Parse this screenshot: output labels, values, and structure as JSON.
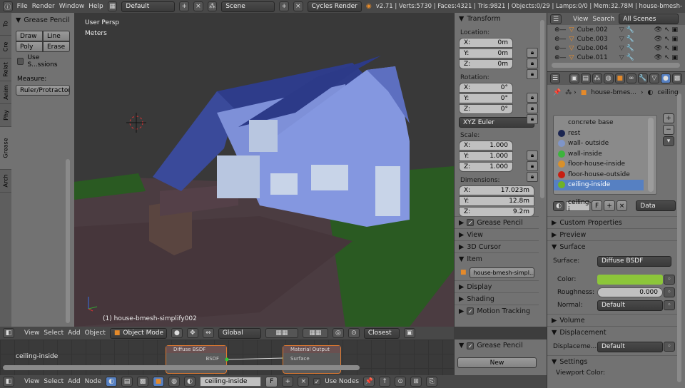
{
  "topbar": {
    "menus": [
      "File",
      "Render",
      "Window",
      "Help"
    ],
    "screen": "Default",
    "scene": "Scene",
    "engine": "Cycles Render",
    "stats": "v2.71 | Verts:5730 | Faces:4321 | Tris:9821 | Objects:0/29 | Lamps:0/0 | Mem:32.78M | house-bmesh-"
  },
  "toolshelf": {
    "tabs": [
      "To",
      "Cre",
      "Relat",
      "Anim",
      "Phy",
      "Grease",
      "Arch"
    ],
    "panel_title": "Grease Pencil",
    "draw": "Draw",
    "line": "Line",
    "poly": "Poly",
    "erase": "Erase",
    "use_sessions": "Use S...ssions",
    "measure_label": "Measure:",
    "ruler": "Ruler/Protractor"
  },
  "viewport": {
    "view_name": "User Persp",
    "units": "Meters",
    "object_label": "(1) house-bmesh-simplify002"
  },
  "npanel": {
    "transform": "Transform",
    "location": "Location:",
    "rotation": "Rotation:",
    "scale": "Scale:",
    "dimensions": "Dimensions:",
    "loc": [
      {
        "axis": "X:",
        "value": "0m"
      },
      {
        "axis": "Y:",
        "value": "0m"
      },
      {
        "axis": "Z:",
        "value": "0m"
      }
    ],
    "rot": [
      {
        "axis": "X:",
        "value": "0°"
      },
      {
        "axis": "Y:",
        "value": "0°"
      },
      {
        "axis": "Z:",
        "value": "0°"
      }
    ],
    "rot_mode": "XYZ Euler",
    "scl": [
      {
        "axis": "X:",
        "value": "1.000"
      },
      {
        "axis": "Y:",
        "value": "1.000"
      },
      {
        "axis": "Z:",
        "value": "1.000"
      }
    ],
    "dim": [
      {
        "axis": "X:",
        "value": "17.023m"
      },
      {
        "axis": "Y:",
        "value": "12.8m"
      },
      {
        "axis": "Z:",
        "value": "9.2m"
      }
    ],
    "grease_pencil": "Grease Pencil",
    "view": "View",
    "cursor": "3D Cursor",
    "item": "Item",
    "item_name": "house-bmesh-simpl...",
    "display": "Display",
    "shading": "Shading",
    "motion_tracking": "Motion Tracking"
  },
  "outliner": {
    "view": "View",
    "search": "Search",
    "filter": "All Scenes",
    "items": [
      "Cube.002",
      "Cube.003",
      "Cube.004",
      "Cube.011"
    ]
  },
  "properties": {
    "breadcrumb_object": "house-bmes...",
    "breadcrumb_material": "ceiling",
    "materials": [
      {
        "name": "concrete base",
        "color": "#8a8a8a"
      },
      {
        "name": "rest",
        "color": "#1b2550"
      },
      {
        "name": "wall- outside",
        "color": "#7f95c8"
      },
      {
        "name": "wall-inside",
        "color": "#3cb43c"
      },
      {
        "name": "floor-house-inside",
        "color": "#d8902a"
      },
      {
        "name": "floor-house-outside",
        "color": "#c81e10"
      },
      {
        "name": "ceiling-inside",
        "color": "#6fb228"
      }
    ],
    "selected_material": "ceiling-inside",
    "mat_field": "ceiling-i",
    "fake": "F",
    "link": "Data",
    "custom_properties": "Custom Properties",
    "preview": "Preview",
    "surface_panel": "Surface",
    "surface_label": "Surface:",
    "surface_value": "Diffuse BSDF",
    "color_label": "Color:",
    "color_value": "#8cc63a",
    "roughness_label": "Roughness:",
    "roughness_value": "0.000",
    "normal_label": "Normal:",
    "normal_value": "Default",
    "volume": "Volume",
    "displacement": "Displacement",
    "displacement_label": "Displaceme...",
    "displacement_value": "Default",
    "settings": "Settings",
    "viewport_color": "Viewport Color:"
  },
  "view3d_header": {
    "menus": [
      "View",
      "Select",
      "Add",
      "Object"
    ],
    "mode": "Object Mode",
    "orientation": "Global",
    "snap": "Closest"
  },
  "node_editor": {
    "material_name": "ceiling-inside",
    "node1": "Diffuse BSDF",
    "node1_out": "BSDF",
    "node2": "Material Output",
    "node2_in": "Surface",
    "gp_panel": "Grease Pencil",
    "new": "New"
  },
  "node_header": {
    "menus": [
      "View",
      "Select",
      "Add",
      "Node"
    ],
    "material": "ceiling-inside",
    "fake": "F",
    "use_nodes": "Use Nodes"
  }
}
